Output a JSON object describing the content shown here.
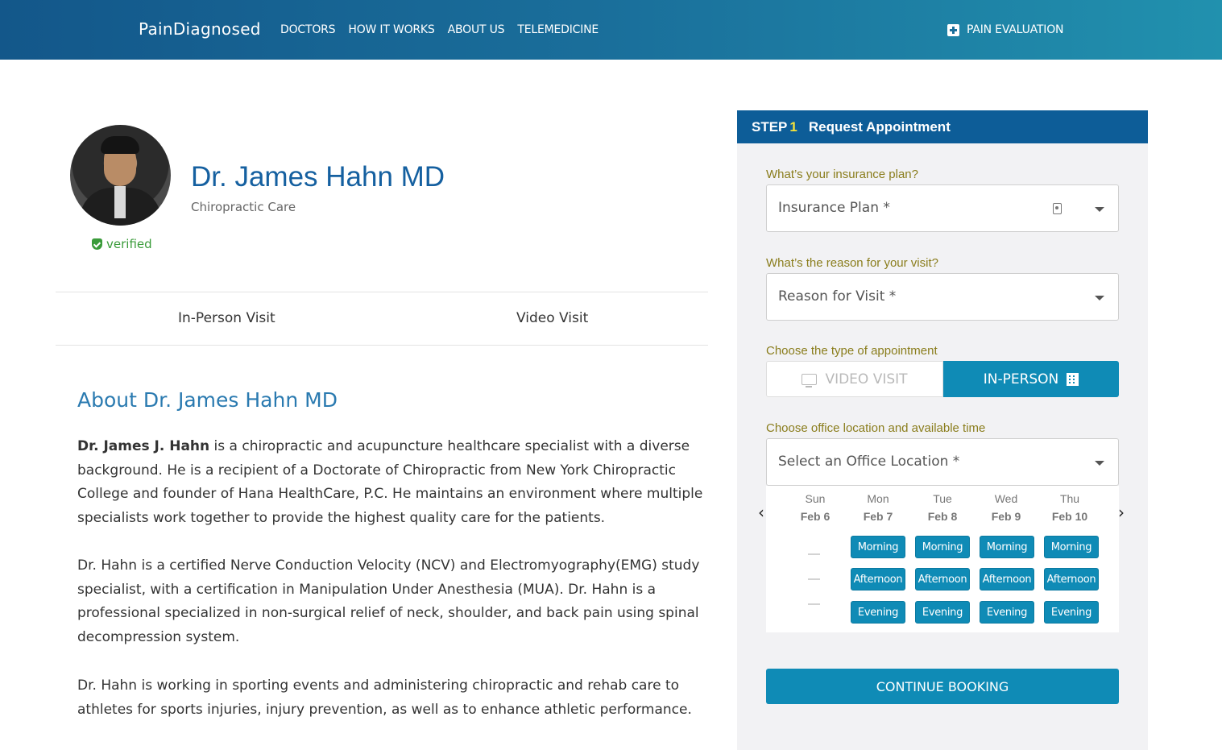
{
  "header": {
    "logo": "PainDiagnosed",
    "nav": [
      "DOCTORS",
      "HOW IT WORKS",
      "ABOUT US",
      "TELEMEDICINE"
    ],
    "cta": "PAIN EVALUATION"
  },
  "profile": {
    "name": "Dr. James Hahn MD",
    "specialty": "Chiropractic Care",
    "verified": "verified",
    "visit_tabs": [
      "In-Person Visit",
      "Video Visit"
    ]
  },
  "about": {
    "title": "About Dr. James Hahn MD",
    "p1_bold": "Dr. James J. Hahn",
    "p1_rest": " is a chiropractic and acupuncture healthcare specialist with a diverse background. He is a recipient of a Doctorate of Chiropractic from New York Chiropractic College and founder of Hana HealthCare, P.C. He maintains an environment where multiple specialists work together to provide the highest quality care for the patients.",
    "p2": "Dr. Hahn is a certified Nerve Conduction Velocity (NCV) and Electromyography(EMG) study specialist, with a certification in Manipulation Under Anesthesia (MUA). Dr. Hahn is a professional specialized in non-surgical relief of neck, shoulder, and back pain using spinal decompression system.",
    "p3": "Dr. Hahn is working in sporting events and administering chiropractic and rehab care to athletes for sports injuries, injury prevention, as well as to enhance athletic performance."
  },
  "booking": {
    "step_label": "STEP",
    "step_num": "1",
    "step_title": "Request Appointment",
    "q_insurance": "What’s your insurance plan?",
    "insurance_placeholder": "Insurance Plan *",
    "q_reason": "What’s the reason for your visit?",
    "reason_placeholder": "Reason for Visit *",
    "q_type": "Choose the type of appointment",
    "type_video": "VIDEO VISIT",
    "type_inperson": "IN-PERSON",
    "q_location": "Choose office location and available time",
    "location_placeholder": "Select an Office Location *",
    "days": [
      {
        "name": "Sun",
        "date": "Feb 6"
      },
      {
        "name": "Mon",
        "date": "Feb 7"
      },
      {
        "name": "Tue",
        "date": "Feb 8"
      },
      {
        "name": "Wed",
        "date": "Feb 9"
      },
      {
        "name": "Thu",
        "date": "Feb 10"
      }
    ],
    "slots": [
      "Morning",
      "Afternoon",
      "Evening"
    ],
    "continue": "CONTINUE BOOKING",
    "accent_color": "#0f8bb6",
    "header_color": "#0d5d98"
  }
}
